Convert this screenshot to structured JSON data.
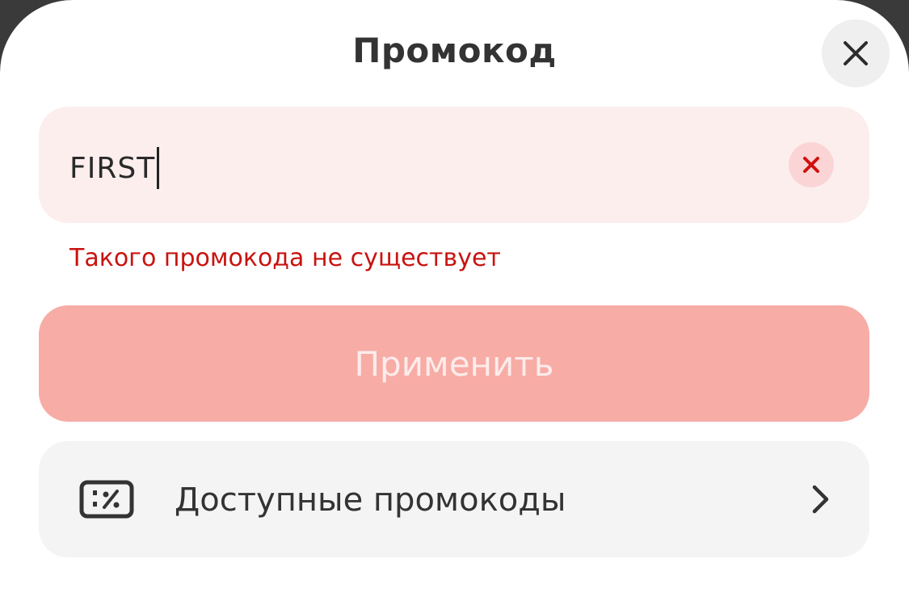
{
  "sheet": {
    "title": "Промокод"
  },
  "promo_input": {
    "value": "FIRST",
    "error": "Такого промокода не существует"
  },
  "apply_button": {
    "label": "Применить"
  },
  "available_promos": {
    "label": "Доступные промокоды",
    "icon": "percent-ticket-icon"
  },
  "colors": {
    "error": "#c8130f",
    "input_bg_error": "#fdeeee",
    "apply_disabled_bg": "#f7aca6"
  }
}
